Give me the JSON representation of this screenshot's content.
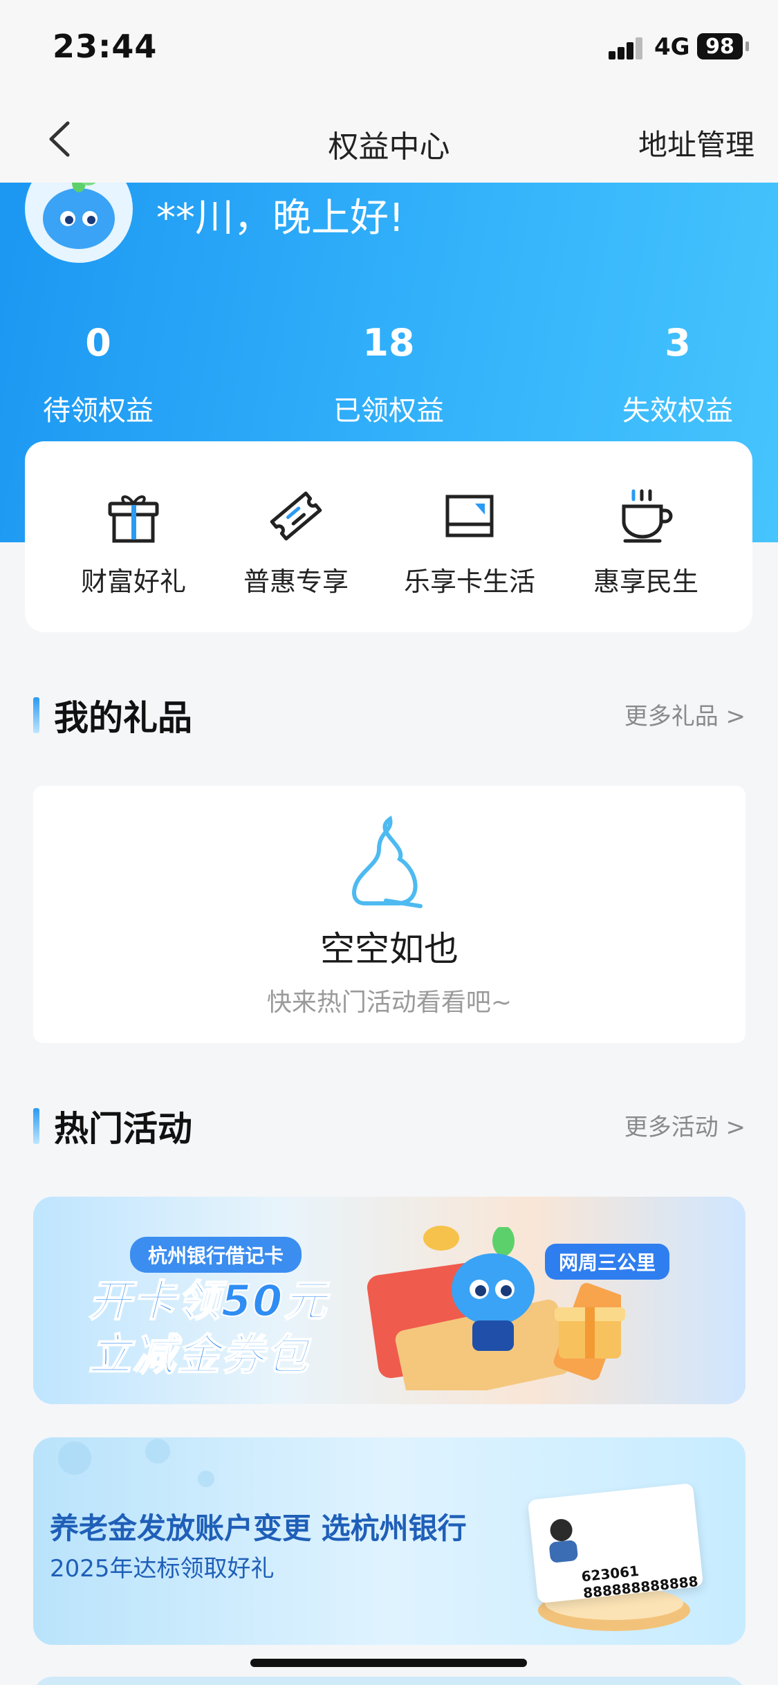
{
  "status_bar": {
    "time": "23:44",
    "network": "4G",
    "battery": "98"
  },
  "nav": {
    "title": "权益中心",
    "action": "地址管理",
    "back_icon": "chevron-left-icon"
  },
  "header": {
    "greeting": "**川，晚上好!",
    "stats": [
      {
        "value": "0",
        "label": "待领权益"
      },
      {
        "value": "18",
        "label": "已领权益"
      },
      {
        "value": "3",
        "label": "失效权益"
      }
    ]
  },
  "quick_menu": [
    {
      "label": "财富好礼",
      "icon": "gift-icon"
    },
    {
      "label": "普惠专享",
      "icon": "ticket-icon"
    },
    {
      "label": "乐享卡生活",
      "icon": "card-icon"
    },
    {
      "label": "惠享民生",
      "icon": "coffee-cup-icon"
    }
  ],
  "gifts": {
    "title": "我的礼品",
    "more": "更多礼品 >",
    "empty_title": "空空如也",
    "empty_sub": "快来热门活动看看吧~"
  },
  "activities": {
    "title": "热门活动",
    "more": "更多活动 >",
    "banner1": {
      "tag": "杭州银行借记卡",
      "line1": "开卡领50元",
      "line2": "立减金券包",
      "side_tag": "网周三公里"
    },
    "banner2": {
      "title": "养老金发放账户变更  选杭州银行",
      "subtitle": "2025年达标领取好礼",
      "card_number": "623061 888888888888"
    }
  },
  "colors": {
    "header_blue": "#1c97f2",
    "accent_blue": "#3b8df0",
    "page_bg": "#f5f6f8"
  }
}
